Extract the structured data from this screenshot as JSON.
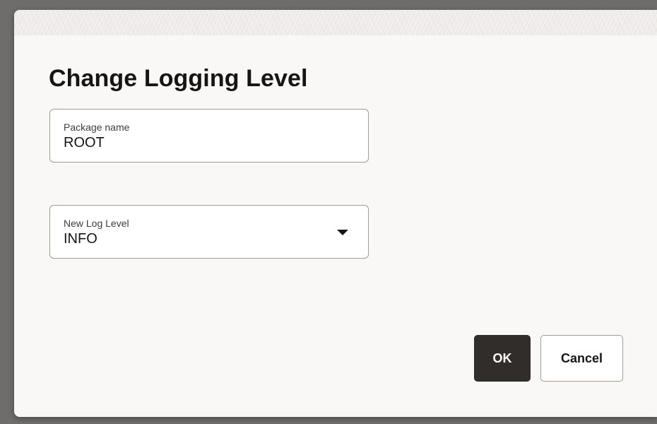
{
  "dialog": {
    "title": "Change Logging Level",
    "package_field": {
      "label": "Package name",
      "value": "ROOT"
    },
    "level_field": {
      "label": "New Log Level",
      "selected": "INFO",
      "icon": "caret-down-icon"
    },
    "buttons": {
      "ok_label": "OK",
      "cancel_label": "Cancel"
    }
  },
  "colors": {
    "backdrop": "#6e6d6b",
    "dialog_bg": "#f9f8f6",
    "primary_button": "#312d2a",
    "text": "#161513",
    "border": "#9f9c97"
  }
}
